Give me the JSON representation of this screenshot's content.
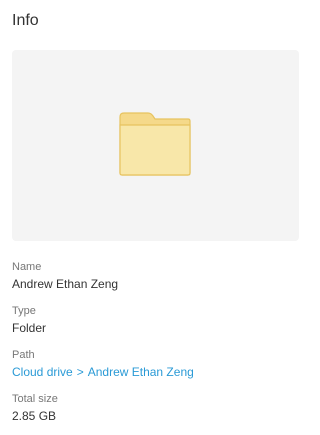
{
  "panel": {
    "title": "Info"
  },
  "preview": {
    "icon": "folder-icon",
    "colors": {
      "folder_body": "#f8e7a9",
      "folder_tab": "#f5d98a",
      "folder_stroke": "#e7c35f",
      "background": "#f4f4f4"
    }
  },
  "details": {
    "name": {
      "label": "Name",
      "value": "Andrew Ethan Zeng"
    },
    "type": {
      "label": "Type",
      "value": "Folder"
    },
    "path": {
      "label": "Path",
      "segments": [
        "Cloud drive",
        "Andrew Ethan Zeng"
      ],
      "separator": ">",
      "color": "#2a9ad6"
    },
    "total_size": {
      "label": "Total size",
      "value": "2.85 GB"
    }
  }
}
